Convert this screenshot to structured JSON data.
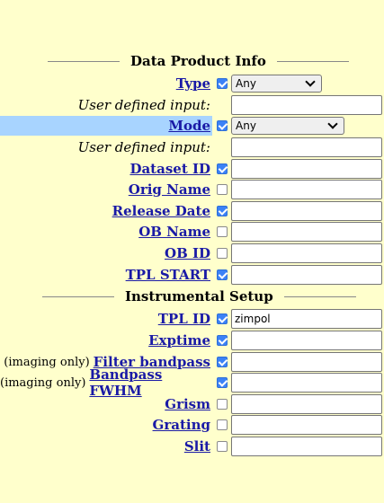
{
  "sections": [
    {
      "title": "Data Product Info"
    },
    {
      "title": "Instrumental Setup"
    }
  ],
  "fields": {
    "type": {
      "label": "Type",
      "checked": true,
      "select_value": "Any"
    },
    "type_user": {
      "label": "User defined input:",
      "value": ""
    },
    "mode": {
      "label": "Mode",
      "checked": true,
      "select_value": "Any"
    },
    "mode_user": {
      "label": "User defined input:",
      "value": ""
    },
    "dataset_id": {
      "label": "Dataset ID",
      "checked": true,
      "value": ""
    },
    "orig_name": {
      "label": "Orig Name",
      "checked": false,
      "value": ""
    },
    "release_date": {
      "label": "Release Date",
      "checked": true,
      "value": ""
    },
    "ob_name": {
      "label": "OB Name",
      "checked": false,
      "value": ""
    },
    "ob_id": {
      "label": "OB ID",
      "checked": false,
      "value": ""
    },
    "tpl_start": {
      "label": "TPL START",
      "checked": true,
      "value": ""
    },
    "tpl_id": {
      "label": "TPL ID",
      "checked": true,
      "value": "zimpol"
    },
    "exptime": {
      "label": "Exptime",
      "checked": true,
      "value": ""
    },
    "filter_bandpass": {
      "prefix": "(imaging only)",
      "label": "Filter bandpass",
      "checked": true,
      "value": ""
    },
    "bandpass_fwhm": {
      "prefix": "(imaging only)",
      "label": "Bandpass FWHM",
      "checked": true,
      "value": ""
    },
    "grism": {
      "label": "Grism",
      "checked": false,
      "value": ""
    },
    "grating": {
      "label": "Grating",
      "checked": false,
      "value": ""
    },
    "slit": {
      "label": "Slit",
      "checked": false,
      "value": ""
    }
  },
  "colors": {
    "background": "#ffffcc",
    "link": "#1a1aa6",
    "highlight": "#a8d4ff",
    "checkbox": "#3b82f6"
  }
}
